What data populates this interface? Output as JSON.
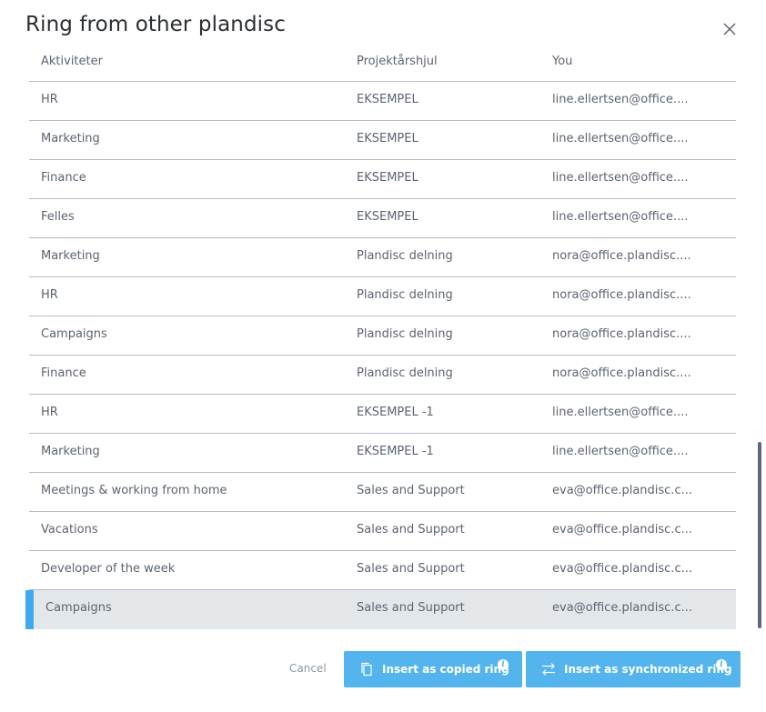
{
  "dialog": {
    "title": "Ring from other plandisc"
  },
  "table": {
    "columns": [
      "Aktiviteter",
      "Projektårshjul",
      "You"
    ],
    "rows": [
      {
        "name": "HR",
        "plandisc": "EKSEMPEL",
        "owner": "line.ellertsen@office...."
      },
      {
        "name": "Marketing",
        "plandisc": "EKSEMPEL",
        "owner": "line.ellertsen@office...."
      },
      {
        "name": "Finance",
        "plandisc": "EKSEMPEL",
        "owner": "line.ellertsen@office...."
      },
      {
        "name": "Felles",
        "plandisc": "EKSEMPEL",
        "owner": "line.ellertsen@office...."
      },
      {
        "name": "Marketing",
        "plandisc": "Plandisc delning",
        "owner": "nora@office.plandisc...."
      },
      {
        "name": "HR",
        "plandisc": "Plandisc delning",
        "owner": "nora@office.plandisc...."
      },
      {
        "name": "Campaigns",
        "plandisc": "Plandisc delning",
        "owner": "nora@office.plandisc...."
      },
      {
        "name": "Finance",
        "plandisc": "Plandisc delning",
        "owner": "nora@office.plandisc...."
      },
      {
        "name": "HR",
        "plandisc": "EKSEMPEL -1",
        "owner": "line.ellertsen@office...."
      },
      {
        "name": "Marketing",
        "plandisc": "EKSEMPEL -1",
        "owner": "line.ellertsen@office...."
      },
      {
        "name": "Meetings & working from home",
        "plandisc": "Sales and Support",
        "owner": "eva@office.plandisc.c..."
      },
      {
        "name": "Vacations",
        "plandisc": "Sales and Support",
        "owner": "eva@office.plandisc.c..."
      },
      {
        "name": "Developer of the week",
        "plandisc": "Sales and Support",
        "owner": "eva@office.plandisc.c..."
      },
      {
        "name": "Campaigns",
        "plandisc": "Sales and Support",
        "owner": "eva@office.plandisc.c...",
        "selected": true
      }
    ]
  },
  "footer": {
    "cancel_label": "Cancel",
    "copied_label": "Insert as copied ring",
    "sync_label": "Insert as synchronized ring",
    "info_glyph": "i"
  },
  "colors": {
    "accent": "#3fa9f0",
    "button": "#54b4ee",
    "selected_row": "#e4e7ea",
    "scrollbar": "#5b6680"
  }
}
